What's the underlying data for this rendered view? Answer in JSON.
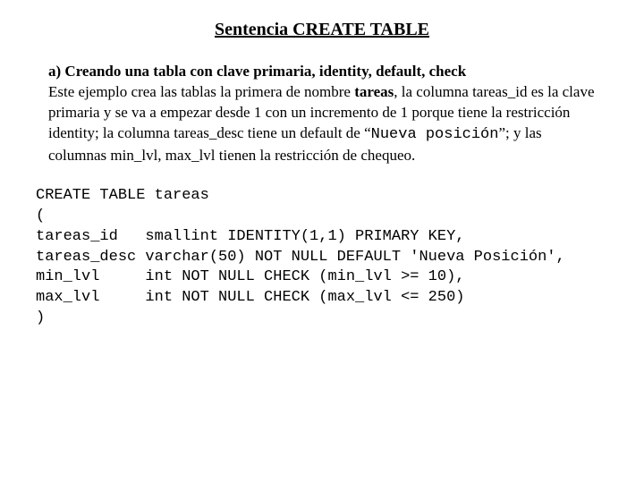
{
  "title": "Sentencia CREATE TABLE",
  "para": {
    "heading": "a) Creando una tabla con clave primaria, identity, default, check",
    "t1": "Este ejemplo crea las tablas la primera de nombre ",
    "b1": "tareas",
    "t2": ", la columna tareas_id es la clave primaria y se va a empezar desde 1 con un incremento de 1 porque tiene la restricción identity; la columna tareas_desc tiene un default de “",
    "code1": "Nueva posición",
    "t3": "”; y las columnas min_lvl, max_lvl tienen la restricción de chequeo."
  },
  "code": "CREATE TABLE tareas\n(\ntareas_id   smallint IDENTITY(1,1) PRIMARY KEY,\ntareas_desc varchar(50) NOT NULL DEFAULT 'Nueva Posición',\nmin_lvl     int NOT NULL CHECK (min_lvl >= 10),\nmax_lvl     int NOT NULL CHECK (max_lvl <= 250)\n)"
}
